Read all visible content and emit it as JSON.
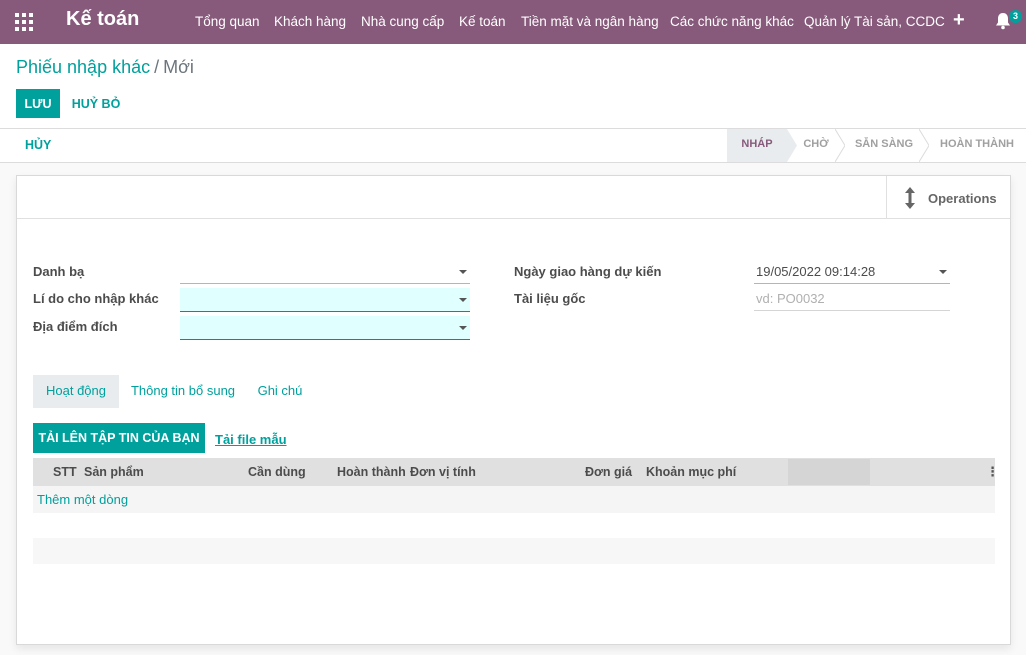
{
  "navbar": {
    "brand": "Kế toán",
    "menu": [
      "Tổng quan",
      "Khách hàng",
      "Nhà cung cấp",
      "Kế toán",
      "Tiền mặt và ngân hàng",
      "Các chức năng khác",
      "Quản lý Tài sản, CCDC"
    ],
    "add_icon": "plus-icon",
    "notification_count": "3",
    "colors": {
      "primary": "#875a7b",
      "accent": "#00a09d"
    }
  },
  "breadcrumb": {
    "parent": "Phiếu nhập khác",
    "separator": "/",
    "current": "Mới"
  },
  "toolbar": {
    "save_label": "LƯU",
    "discard_label": "HUỶ BỎ"
  },
  "statusbar": {
    "cancel_label": "HỦY",
    "stages": [
      "NHÁP",
      "CHỜ",
      "SẴN SÀNG",
      "HOÀN THÀNH"
    ],
    "active_stage": "NHÁP"
  },
  "smart_buttons": {
    "operations_label": "Operations",
    "operations_icon": "arrows-v-icon"
  },
  "form": {
    "contact_label": "Danh bạ",
    "contact_value": "",
    "reason_label": "Lí do cho nhập khác",
    "reason_value": "",
    "destination_label": "Địa điểm đích",
    "destination_value": "",
    "scheduled_date_label": "Ngày giao hàng dự kiến",
    "scheduled_date_value": "19/05/2022 09:14:28",
    "source_doc_label": "Tài liệu gốc",
    "source_doc_placeholder": "vd: PO0032"
  },
  "tabs": [
    "Hoạt động",
    "Thông tin bổ sung",
    "Ghi chú"
  ],
  "active_tab": "Hoạt động",
  "upload": {
    "button_label": "TẢI LÊN TẬP TIN CỦA BẠN",
    "template_link": "Tải file mẫu"
  },
  "table": {
    "columns": [
      "STT",
      "Sản phẩm",
      "Cần dùng",
      "Hoàn thành",
      "Đơn vị tính",
      "Đơn giá",
      "Khoản mục phí"
    ],
    "add_line_label": "Thêm một dòng"
  }
}
